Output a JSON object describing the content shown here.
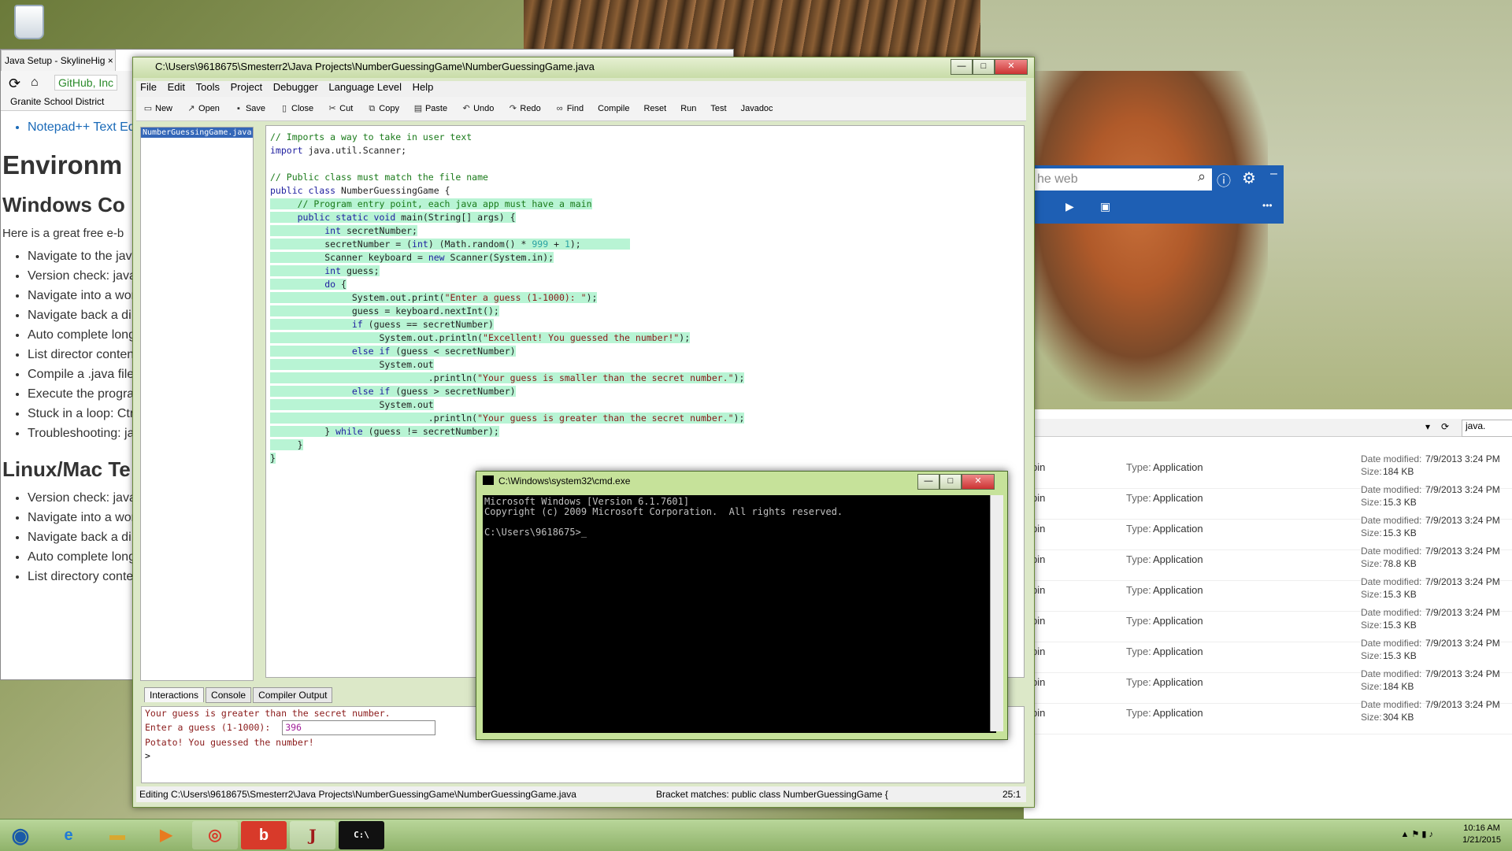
{
  "browser": {
    "tab_title": "Java Setup - SkylineHig",
    "close_tab": "×",
    "github_badge": "GitHub, Inc",
    "bookmark": "Granite School District",
    "partial_link": "Notepad++ Text Ed",
    "heading1": "Environm",
    "heading_windows": "Windows Co",
    "paragraph": "Here is a great free e-b",
    "windows_list": [
      "Navigate to the java",
      "Version check: java",
      "Navigate into a wor",
      "Navigate back a di",
      "Auto complete long",
      "List director conten",
      "Compile a .java file",
      "Execute the progra",
      "Stuck in a loop: Ctr",
      "Troubleshooting: ja"
    ],
    "heading_linux": "Linux/Mac Te",
    "linux_list": [
      "Version check: java",
      "Navigate into a wor",
      "Navigate back a di",
      "Auto complete long",
      "List directory conte"
    ]
  },
  "search_panel": {
    "placeholder": "he web",
    "menu": "–",
    "more": "•••"
  },
  "explorer": {
    "address_value": "java.",
    "rows": [
      {
        "name_frag": "bin",
        "type_label": "Type:",
        "type": "Application",
        "date_label": "Date modified:",
        "date": "7/9/2013 3:24 PM",
        "size_label": "Size:",
        "size": "184 KB"
      },
      {
        "name_frag": "bin",
        "type_label": "Type:",
        "type": "Application",
        "date_label": "Date modified:",
        "date": "7/9/2013 3:24 PM",
        "size_label": "Size:",
        "size": "15.3 KB"
      },
      {
        "name_frag": "bin",
        "type_label": "Type:",
        "type": "Application",
        "date_label": "Date modified:",
        "date": "7/9/2013 3:24 PM",
        "size_label": "Size:",
        "size": "15.3 KB"
      },
      {
        "name_frag": "bin",
        "type_label": "Type:",
        "type": "Application",
        "date_label": "Date modified:",
        "date": "7/9/2013 3:24 PM",
        "size_label": "Size:",
        "size": "78.8 KB"
      },
      {
        "name_frag": "bin",
        "type_label": "Type:",
        "type": "Application",
        "date_label": "Date modified:",
        "date": "7/9/2013 3:24 PM",
        "size_label": "Size:",
        "size": "15.3 KB"
      },
      {
        "name_frag": "bin",
        "type_label": "Type:",
        "type": "Application",
        "date_label": "Date modified:",
        "date": "7/9/2013 3:24 PM",
        "size_label": "Size:",
        "size": "15.3 KB"
      },
      {
        "name_frag": "bin",
        "type_label": "Type:",
        "type": "Application",
        "date_label": "Date modified:",
        "date": "7/9/2013 3:24 PM",
        "size_label": "Size:",
        "size": "15.3 KB"
      },
      {
        "name_frag": "bin",
        "type_label": "Type:",
        "type": "Application",
        "date_label": "Date modified:",
        "date": "7/9/2013 3:24 PM",
        "size_label": "Size:",
        "size": "184 KB"
      },
      {
        "name_frag": "bin",
        "type_label": "Type:",
        "type": "Application",
        "date_label": "Date modified:",
        "date": "7/9/2013 3:24 PM",
        "size_label": "Size:",
        "size": "304 KB"
      }
    ]
  },
  "drjava": {
    "title": "C:\\Users\\9618675\\Smesterr2\\Java Projects\\NumberGuessingGame\\NumberGuessingGame.java",
    "win_buttons": {
      "min": "—",
      "max": "□",
      "close": "✕"
    },
    "menu": [
      "File",
      "Edit",
      "Tools",
      "Project",
      "Debugger",
      "Language Level",
      "Help"
    ],
    "toolbar": [
      {
        "label": "New",
        "icon": "new-file-icon",
        "glyph": "▭"
      },
      {
        "label": "Open",
        "icon": "open-folder-icon",
        "glyph": "↗"
      },
      {
        "label": "Save",
        "icon": "save-disk-icon",
        "glyph": "▪"
      },
      {
        "label": "Close",
        "icon": "close-file-icon",
        "glyph": "▯"
      },
      {
        "label": "Cut",
        "icon": "scissors-icon",
        "glyph": "✂"
      },
      {
        "label": "Copy",
        "icon": "copy-icon",
        "glyph": "⧉"
      },
      {
        "label": "Paste",
        "icon": "clipboard-icon",
        "glyph": "▤"
      },
      {
        "label": "Undo",
        "icon": "undo-icon",
        "glyph": "↶"
      },
      {
        "label": "Redo",
        "icon": "redo-icon",
        "glyph": "↷"
      },
      {
        "label": "Find",
        "icon": "binoculars-icon",
        "glyph": "∞"
      },
      {
        "label": "Compile",
        "icon": "",
        "glyph": ""
      },
      {
        "label": "Reset",
        "icon": "",
        "glyph": ""
      },
      {
        "label": "Run",
        "icon": "",
        "glyph": ""
      },
      {
        "label": "Test",
        "icon": "",
        "glyph": ""
      },
      {
        "label": "Javadoc",
        "icon": "",
        "glyph": ""
      }
    ],
    "file_list": [
      "NumberGuessingGame.java"
    ],
    "code": {
      "l1": "// Imports a way to take in user text",
      "l2a": "import",
      "l2b": " java.util.Scanner;",
      "l4": "// Public class must match the file name",
      "l5a": "public class",
      "l5b": " NumberGuessingGame {",
      "l6": "// Program entry point, each java app must have a main",
      "l7a": "public static void",
      "l7b": " main(String[] args) {",
      "l8a": "int",
      "l8b": " secretNumber;",
      "l9a": "secretNumber = (",
      "l9b": "int",
      "l9c": ") (Math.random() * ",
      "l9d": "999",
      "l9e": " + ",
      "l9f": "1",
      "l9g": ");",
      "l10a": "Scanner keyboard = ",
      "l10b": "new",
      "l10c": " Scanner(System.in);",
      "l11a": "int",
      "l11b": " guess;",
      "l12a": "do",
      "l12b": " {",
      "l13a": "System.out.print(",
      "l13b": "\"Enter a guess (1-1000): \"",
      "l13c": ");",
      "l14": "guess = keyboard.nextInt();",
      "l15a": "if",
      "l15b": " (guess == secretNumber)",
      "l16a": "System.out.println(",
      "l16b": "\"Excellent! You guessed the number!\"",
      "l16c": ");",
      "l17a": "else if",
      "l17b": " (guess < secretNumber)",
      "l18": "System.out",
      "l19a": ".println(",
      "l19b": "\"Your guess is smaller than the secret number.\"",
      "l19c": ");",
      "l20a": "else if",
      "l20b": " (guess > secretNumber)",
      "l21": "System.out",
      "l22a": ".println(",
      "l22b": "\"Your guess is greater than the secret number.\"",
      "l22c": ");",
      "l23a": "} ",
      "l23b": "while",
      "l23c": " (guess != secretNumber);",
      "l24": "}",
      "l25": "}"
    },
    "tabs": [
      "Interactions",
      "Console",
      "Compiler Output"
    ],
    "interactions": {
      "line1": "Your guess is greater than the secret number.",
      "prompt": "Enter a guess (1-1000):",
      "input_value": "396",
      "line3": "Potato! You guessed the number!",
      "line4": ">"
    },
    "status": {
      "editing": "Editing C:\\Users\\9618675\\Smesterr2\\Java Projects\\NumberGuessingGame\\NumberGuessingGame.java",
      "bracket": "Bracket matches: public class NumberGuessingGame {",
      "position": "25:1"
    }
  },
  "cmd": {
    "title": "C:\\Windows\\system32\\cmd.exe",
    "line1": "Microsoft Windows [Version 6.1.7601]",
    "line2": "Copyright (c) 2009 Microsoft Corporation.  All rights reserved.",
    "line3": "C:\\Users\\9618675>_"
  },
  "taskbar": {
    "clock_time": "10:16 AM",
    "clock_date": "1/21/2015",
    "apps": [
      "start-orb",
      "internet-explorer",
      "file-explorer",
      "media-player",
      "chrome",
      "b-app",
      "drjava",
      "command-prompt"
    ],
    "drjava_glyph": "J",
    "b_glyph": "b",
    "ie_glyph": "e",
    "cmd_glyph": "C:\\",
    "tray_arrow": "▲",
    "tray_flag": "⚑",
    "tray_signal": "▮",
    "tray_sound": "♪"
  },
  "colors": {
    "accent_green": "#c6e29a",
    "search_blue": "#1e5fb4",
    "highlight": "#b8f4d4"
  }
}
